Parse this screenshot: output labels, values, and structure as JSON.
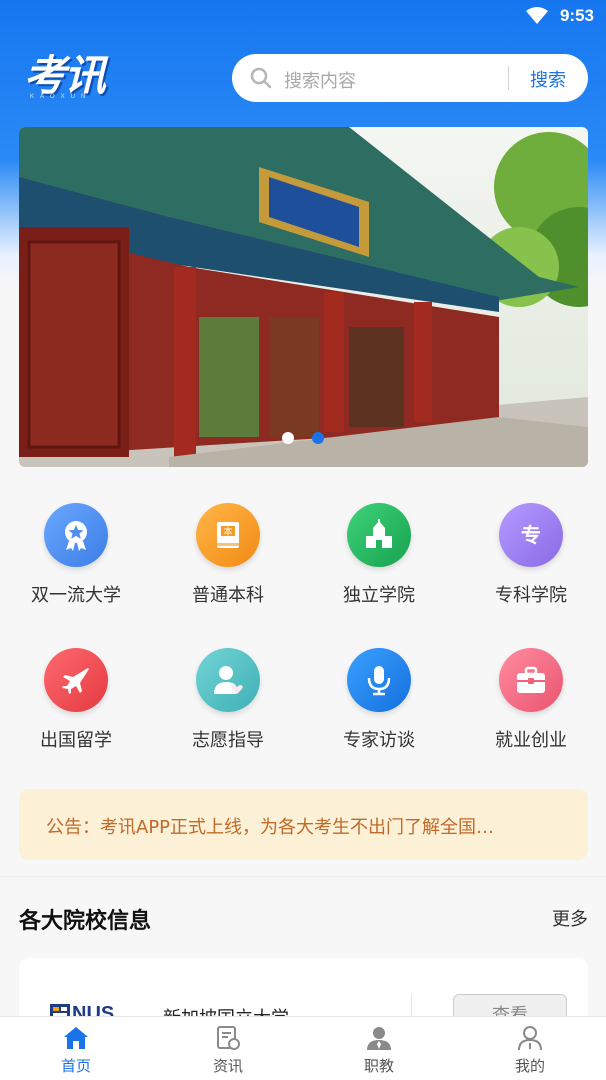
{
  "status_bar": {
    "time": "9:53"
  },
  "header": {
    "logo_text": "考讯",
    "logo_subtext": "KAOXUN",
    "search": {
      "placeholder": "搜索内容",
      "button_label": "搜索"
    }
  },
  "banner": {
    "slide_count": 2,
    "active_slide": 2
  },
  "categories": [
    {
      "label": "双一流大学",
      "icon": "medal-star-icon",
      "color": "#4f8ff0"
    },
    {
      "label": "普通本科",
      "icon": "book-icon",
      "color": "#f59a23"
    },
    {
      "label": "独立学院",
      "icon": "school-building-icon",
      "color": "#22b35e"
    },
    {
      "label": "专科学院",
      "icon": "zhuan-badge-icon",
      "color": "#9b7cf0"
    },
    {
      "label": "出国留学",
      "icon": "airplane-icon",
      "color": "#ef4a50"
    },
    {
      "label": "志愿指导",
      "icon": "user-heart-icon",
      "color": "#55c2c6"
    },
    {
      "label": "专家访谈",
      "icon": "microphone-icon",
      "color": "#1e86ef"
    },
    {
      "label": "就业创业",
      "icon": "briefcase-icon",
      "color": "#f0627a"
    }
  ],
  "notice": {
    "text": "公告：考讯APP正式上线，为各大考生不出门了解全国…"
  },
  "section": {
    "title": "各大院校信息",
    "more_label": "更多"
  },
  "school_card": {
    "logo_text": "NUS",
    "name": "新加坡国立大学",
    "action_label": "查看"
  },
  "tabbar": {
    "tabs": [
      {
        "label": "首页",
        "icon": "home-icon",
        "active": true
      },
      {
        "label": "资讯",
        "icon": "news-icon",
        "active": false
      },
      {
        "label": "职教",
        "icon": "teacher-icon",
        "active": false
      },
      {
        "label": "我的",
        "icon": "profile-icon",
        "active": false
      }
    ]
  },
  "colors": {
    "primary": "#1a73e8",
    "notice_bg": "#fcf0d6",
    "notice_text": "#c06a2a"
  }
}
